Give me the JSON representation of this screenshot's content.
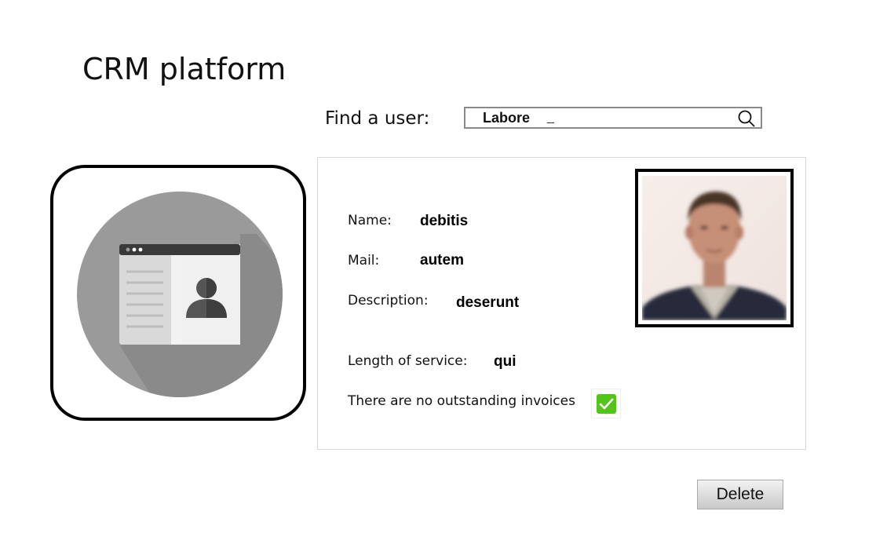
{
  "app": {
    "title": "CRM platform"
  },
  "search": {
    "label": "Find a user:",
    "value": "Labore",
    "caret": "_",
    "icon": "search-icon"
  },
  "app_icon": {
    "icon": "contact-card-icon",
    "colors": {
      "circle": "#9a9a9a",
      "shadow": "#8a8a8a",
      "card_left": "#d9d9d9",
      "card_right": "#f2f2f2",
      "card_header": "#3a3a3a",
      "person": "#555555"
    }
  },
  "user": {
    "fields": {
      "name": {
        "label": "Name:",
        "value": "debitis"
      },
      "mail": {
        "label": "Mail:",
        "value": "autem"
      },
      "description": {
        "label": "Description:",
        "value": "deserunt"
      },
      "length_of_service": {
        "label": "Length of service:",
        "value": "qui"
      }
    },
    "invoices": {
      "label": "There are no outstanding invoices",
      "checked": true,
      "check_color": "#52c41a"
    },
    "photo": {
      "icon": "user-photo"
    }
  },
  "actions": {
    "delete_label": "Delete"
  }
}
